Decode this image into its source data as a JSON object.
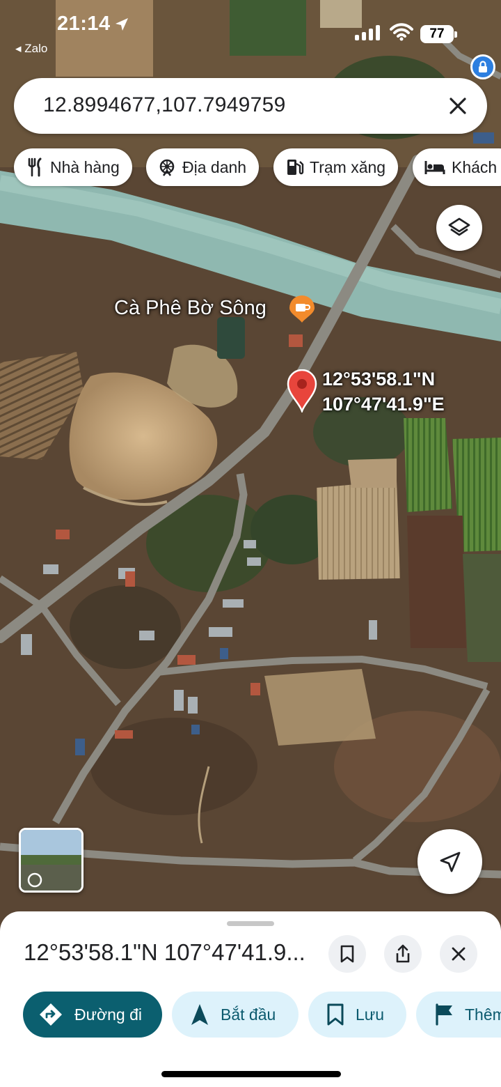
{
  "status_bar": {
    "time": "21:14",
    "back_app": "◂ Zalo",
    "battery": "77"
  },
  "search": {
    "query": "12.8994677,107.7949759"
  },
  "chips": [
    {
      "label": "Nhà hàng",
      "icon": "restaurant-icon"
    },
    {
      "label": "Địa danh",
      "icon": "landmark-icon"
    },
    {
      "label": "Trạm xăng",
      "icon": "gas-station-icon"
    },
    {
      "label": "Khách",
      "icon": "hotel-icon"
    }
  ],
  "map": {
    "place_name": "Cà Phê Bờ Sông",
    "pin_lat": "12°53'58.1\"N",
    "pin_lon": "107°47'41.9\"E",
    "place_icon": "coffee-icon",
    "colors": {
      "pin": "#e8453c",
      "place_icon": "#f28b2c"
    }
  },
  "sheet": {
    "title": "12°53'58.1\"N 107°47'41.9...",
    "actions": [
      {
        "label": "Đường đi",
        "icon": "directions-icon"
      },
      {
        "label": "Bắt đầu",
        "icon": "navigation-arrow-icon"
      },
      {
        "label": "Lưu",
        "icon": "bookmark-icon"
      },
      {
        "label": "Thêm",
        "icon": "flag-icon"
      }
    ],
    "colors": {
      "primary": "#0b5f6f",
      "secondary_bg": "#ddf2fb"
    }
  }
}
